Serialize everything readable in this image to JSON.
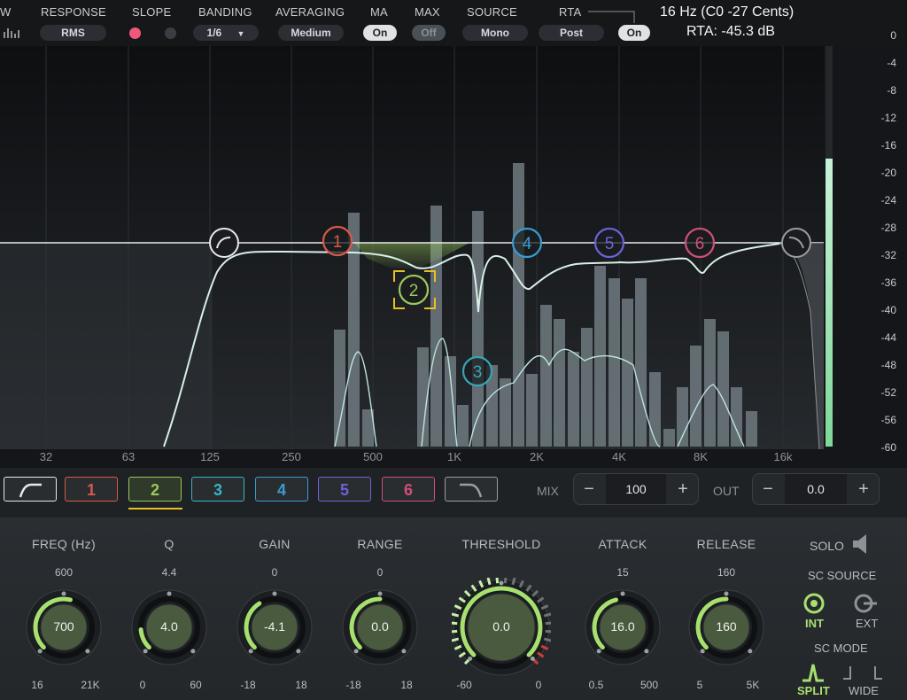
{
  "header": {
    "labels": {
      "view": "W",
      "response": "RESPONSE",
      "slope": "SLOPE",
      "banding": "BANDING",
      "averaging": "AVERAGING",
      "ma": "MA",
      "max": "MAX",
      "source": "SOURCE",
      "rta": "RTA"
    },
    "values": {
      "response": "RMS",
      "banding": "1/6",
      "averaging": "Medium",
      "ma": "On",
      "max": "Off",
      "source": "Mono",
      "rta_point": "Post",
      "rta": "On"
    },
    "readout_note": "16 Hz (C0 -27 Cents)",
    "readout_rta": "RTA: -45.3 dB"
  },
  "graph": {
    "db_scale": [
      "0",
      "-4",
      "-8",
      "-12",
      "-16",
      "-20",
      "-24",
      "-28",
      "-32",
      "-36",
      "-40",
      "-44",
      "-48",
      "-52",
      "-56",
      "-60"
    ],
    "freq_labels": [
      "32",
      "63",
      "125",
      "250",
      "500",
      "1K",
      "2K",
      "4K",
      "8K",
      "16k"
    ],
    "nodes": [
      {
        "label": "1",
        "color": "#d9594a"
      },
      {
        "label": "2",
        "color": "#9bc95a"
      },
      {
        "label": "3",
        "color": "#36a6b3"
      },
      {
        "label": "4",
        "color": "#3a9bd1"
      },
      {
        "label": "5",
        "color": "#6a63d8"
      },
      {
        "label": "6",
        "color": "#cf4f78"
      }
    ],
    "meter_level": 0.72
  },
  "bands": {
    "buttons": [
      {
        "label": "",
        "type": "low-cut",
        "color": "#e6e8ea"
      },
      {
        "label": "1",
        "color": "#d9594a"
      },
      {
        "label": "2",
        "color": "#9bc95a"
      },
      {
        "label": "3",
        "color": "#36b5c4"
      },
      {
        "label": "4",
        "color": "#3a9bd1"
      },
      {
        "label": "5",
        "color": "#6a63d8"
      },
      {
        "label": "6",
        "color": "#cf4f78"
      },
      {
        "label": "",
        "type": "high-cut",
        "color": "#9a9ea2"
      }
    ],
    "mix_label": "MIX",
    "mix_value": "100",
    "out_label": "OUT",
    "out_value": "0.0",
    "minus": "−",
    "plus": "+"
  },
  "controls": {
    "knobs": [
      {
        "title": "FREQ (Hz)",
        "top": "600",
        "min": "16",
        "max": "21K",
        "value": "700",
        "level": 0.55
      },
      {
        "title": "Q",
        "top": "4.4",
        "min": "0",
        "max": "60",
        "value": "4.0",
        "level": 0.15
      },
      {
        "title": "GAIN",
        "top": "0",
        "min": "-18",
        "max": "18",
        "value": "-4.1",
        "level": 0.38
      },
      {
        "title": "RANGE",
        "top": "0",
        "min": "-18",
        "max": "18",
        "value": "0.0",
        "level": 0.5
      },
      {
        "title": "THRESHOLD",
        "top": "",
        "min": "-60",
        "max": "0",
        "value": "0.0",
        "level": 1.0
      },
      {
        "title": "ATTACK",
        "top": "15",
        "min": "0.5",
        "max": "500",
        "value": "16.0",
        "level": 0.45
      },
      {
        "title": "RELEASE",
        "top": "160",
        "min": "5",
        "max": "5K",
        "value": "160",
        "level": 0.5
      }
    ],
    "solo": "SOLO",
    "sc_source": "SC SOURCE",
    "int": "INT",
    "ext": "EXT",
    "sc_mode": "SC MODE",
    "split": "SPLIT",
    "wide": "WIDE",
    "accent": "#a8e070"
  }
}
